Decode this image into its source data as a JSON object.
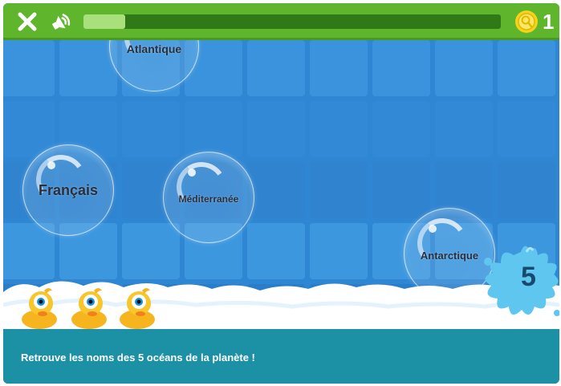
{
  "header": {
    "progress_fraction": 0.1,
    "coin_count": "1"
  },
  "bubbles": [
    {
      "label": "Atlantique"
    },
    {
      "label": "Français"
    },
    {
      "label": "Méditerranée"
    },
    {
      "label": "Antarctique"
    }
  ],
  "round": {
    "number": "5"
  },
  "ducks": {
    "count": 3
  },
  "instruction": {
    "text": "Retrouve les noms des 5 océans de la planète !"
  },
  "colors": {
    "topbar": "#5fb52c",
    "progress_track": "#2f7a17",
    "progress_fill": "#a8e07c",
    "pool": "#2f87d3",
    "instruction_bar": "#1c91a6",
    "coin": "#f5d21b"
  },
  "icons": {
    "close": "close-icon",
    "sound": "speaker-icon",
    "coin": "coin-icon"
  }
}
